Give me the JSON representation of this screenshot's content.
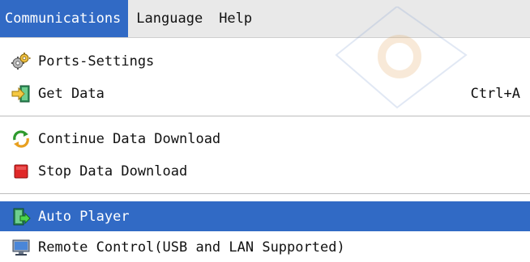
{
  "menubar": {
    "items": [
      {
        "label": "Communications",
        "active": true
      },
      {
        "label": "Language"
      },
      {
        "label": "Help"
      }
    ]
  },
  "menu": {
    "items": [
      {
        "label": "Ports-Settings",
        "icon": "gears-icon"
      },
      {
        "label": "Get Data",
        "icon": "import-arrow-icon",
        "shortcut": "Ctrl+A"
      },
      {
        "label": "Continue Data Download",
        "icon": "refresh-icon"
      },
      {
        "label": "Stop Data Download",
        "icon": "stop-icon"
      },
      {
        "label": "Auto Player",
        "icon": "auto-player-icon",
        "highlighted": true
      },
      {
        "label": "Remote Control(USB and LAN Supported)",
        "icon": "monitor-icon"
      }
    ]
  },
  "colors": {
    "highlight": "#316ac5",
    "menubar_bg": "#e9e9e9",
    "separator": "#bdbdbd"
  }
}
